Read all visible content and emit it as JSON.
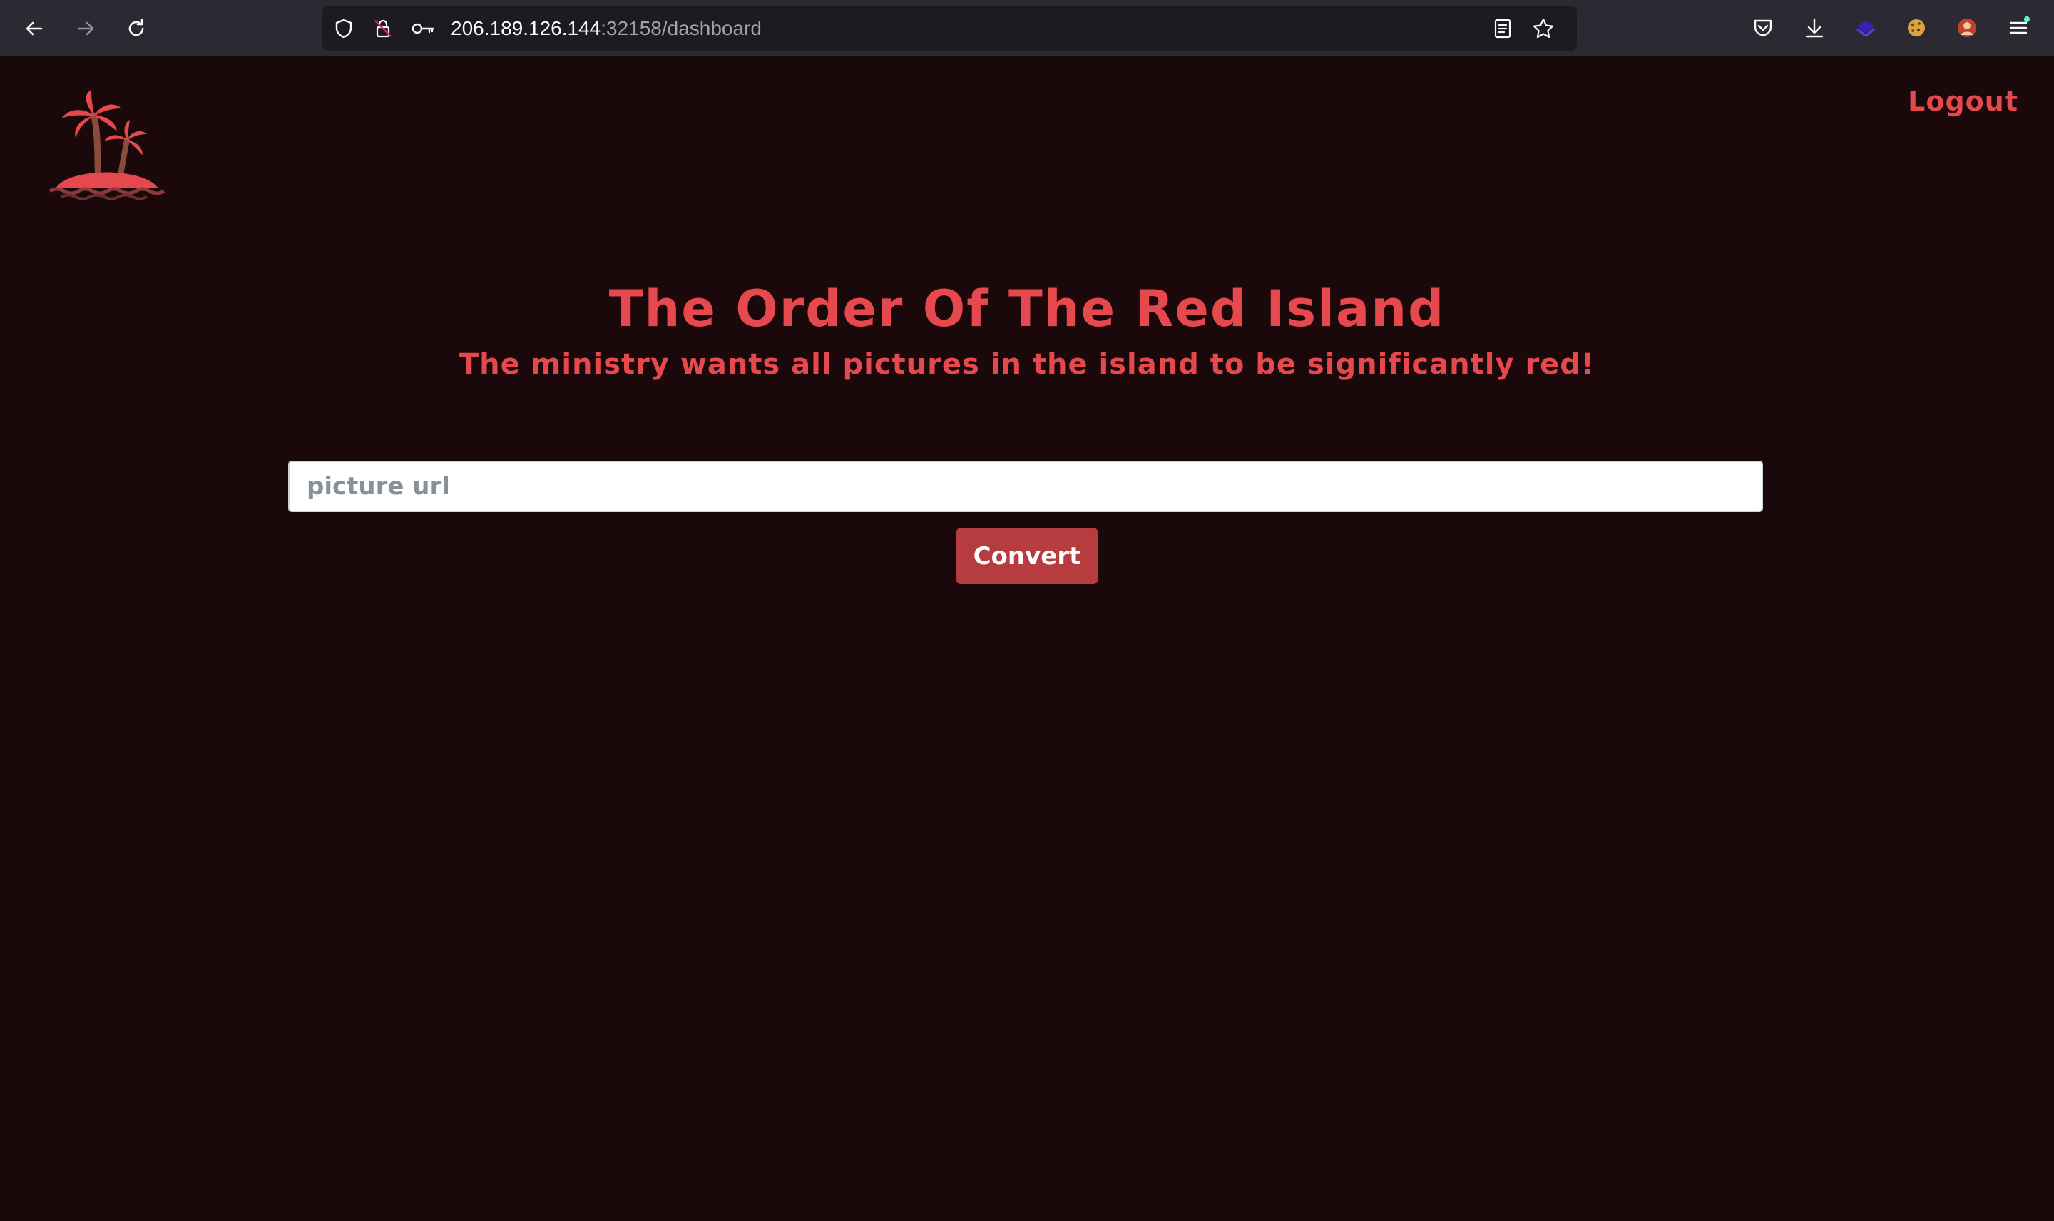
{
  "browser": {
    "url_host": "206.189.126.144",
    "url_path": ":32158/dashboard",
    "icons": [
      "back-arrow-icon",
      "forward-arrow-icon",
      "reload-icon",
      "shield-icon",
      "lock-warning-icon",
      "key-icon",
      "reader-view-icon",
      "bookmark-star-icon",
      "pocket-icon",
      "download-icon",
      "extension-icon",
      "cookie-icon",
      "avatar-icon",
      "menu-icon"
    ]
  },
  "header": {
    "logo_icon": "palm-island-icon",
    "logout_label": "Logout"
  },
  "main": {
    "title": "The Order Of The Red Island",
    "subtitle": "The ministry wants all pictures in the island to be significantly red!",
    "input_placeholder": "picture url",
    "input_value": "",
    "convert_label": "Convert"
  },
  "colors": {
    "background": "#1b080a",
    "accent": "#e5484d",
    "button": "#b73c40"
  }
}
